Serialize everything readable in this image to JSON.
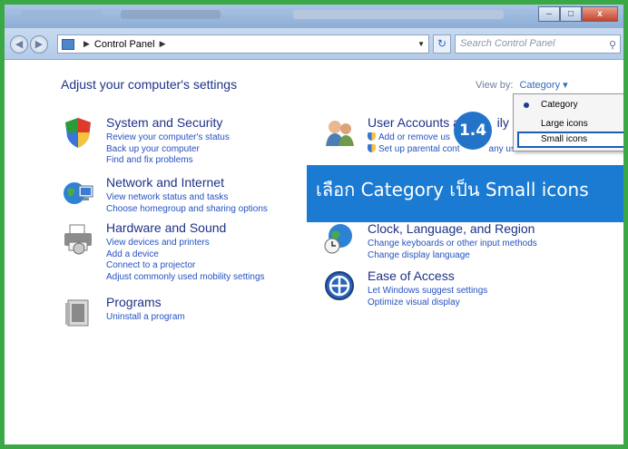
{
  "window": {
    "minimize_glyph": "–",
    "maximize_glyph": "□",
    "close_glyph": "x"
  },
  "address": {
    "crumb": "Control Panel",
    "search_placeholder": "Search Control Panel"
  },
  "content": {
    "heading": "Adjust your computer's settings",
    "view_by_label": "View by:",
    "view_by_value": "Category ▾"
  },
  "groups": [
    {
      "title": "System and Security",
      "icon": "shield-icon",
      "links": [
        "Review your computer's status",
        "Back up your computer",
        "Find and fix problems"
      ]
    },
    {
      "title": "Network and Internet",
      "icon": "globe-network-icon",
      "links": [
        "View network status and tasks",
        "Choose homegroup and sharing options"
      ]
    },
    {
      "title": "Hardware and Sound",
      "icon": "printer-icon",
      "links": [
        "View devices and printers",
        "Add a device",
        "Connect to a projector",
        "Adjust commonly used mobility settings"
      ]
    },
    {
      "title": "Programs",
      "icon": "programs-icon",
      "links": [
        "Uninstall a program"
      ]
    },
    {
      "title": "User Accounts ar",
      "title_right": "ily Sa",
      "icon": "users-icon",
      "links": [
        "Add or remove us",
        "Set up parental cont"
      ],
      "links_right": [
        "any use"
      ]
    },
    {
      "title": "Clock, Language, and Region",
      "icon": "clock-globe-icon",
      "links": [
        "Change keyboards or other input methods",
        "Change display language"
      ]
    },
    {
      "title": "Ease of Access",
      "icon": "ease-of-access-icon",
      "links": [
        "Let Windows suggest settings",
        "Optimize visual display"
      ]
    }
  ],
  "dropdown": {
    "items": [
      "Category",
      "Large icons",
      "Small icons"
    ],
    "selected": "Category",
    "highlighted": "Small icons"
  },
  "overlay": {
    "step": "1.4",
    "caption": "เลือก Category เป็น Small icons"
  },
  "colors": {
    "heading": "#1e3287",
    "link": "#2452c2",
    "banner": "#1b7bd3",
    "frame": "#3aa845"
  }
}
